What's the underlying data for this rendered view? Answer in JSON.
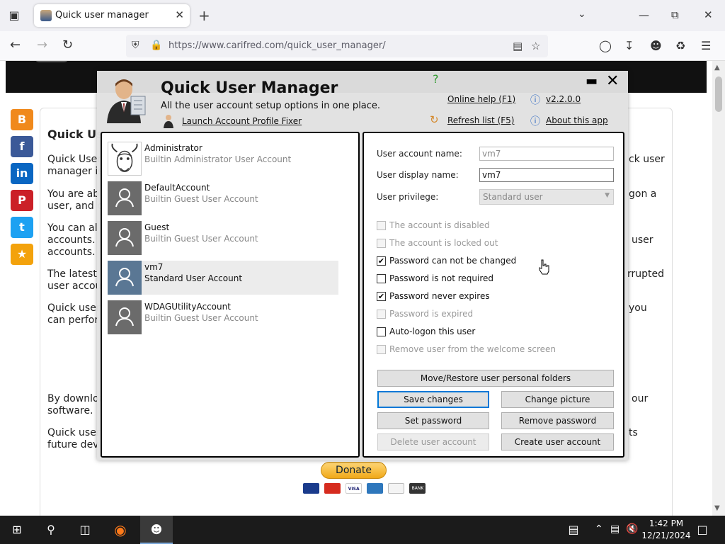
{
  "browser": {
    "tab_title": "Quick user manager",
    "url": "https://www.carifred.com/quick_user_manager/"
  },
  "page": {
    "article_title": "Quick Us",
    "para1_left": "Quick User",
    "para1_left2": "manager is",
    "para1_right": "ck user",
    "para2_left": "You are ab",
    "para2_left2": "user, and c",
    "para2_right": "gon a",
    "para3_left": "You can al",
    "para3_left2": "accounts.",
    "para3_left3": "accounts.",
    "para3_right": "user",
    "para4_left": "The latest",
    "para4_left2": "user accou",
    "para4_right": "rrupted",
    "para5_left": "Quick user",
    "para5_left2": "can perfor",
    "para5_right": "you",
    "para6_left": "By downloa",
    "para6_left2": "software.",
    "para6_right": "our",
    "para7_left": "Quick user",
    "para7_left2": "future dev",
    "para7_right": "ts",
    "donate_label": "Donate",
    "card_visa": "VISA",
    "card_bank": "BANK"
  },
  "app": {
    "title": "Quick User Manager",
    "subtitle": "All the user account setup options in one place.",
    "fixer_link": "Launch Account Profile Fixer",
    "online_help": "Online help (F1)",
    "refresh": "Refresh list (F5)",
    "version": "v2.2.0.0",
    "about": "About this app",
    "users": [
      {
        "name": "Administrator",
        "desc": "Builtin Administrator User Account"
      },
      {
        "name": "DefaultAccount",
        "desc": "Builtin Guest User Account"
      },
      {
        "name": "Guest",
        "desc": "Builtin Guest User Account"
      },
      {
        "name": "vm7",
        "desc": "Standard User Account"
      },
      {
        "name": "WDAGUtilityAccount",
        "desc": "Builtin Guest User Account"
      }
    ],
    "fields": {
      "account_name_label": "User account name:",
      "account_name_value": "vm7",
      "display_name_label": "User display name:",
      "display_name_value": "vm7",
      "privilege_label": "User privilege:",
      "privilege_value": "Standard user"
    },
    "options": [
      {
        "label": "The account is disabled",
        "checked": false,
        "enabled": false
      },
      {
        "label": "The account is locked out",
        "checked": false,
        "enabled": false
      },
      {
        "label": "Password can not be changed",
        "checked": true,
        "enabled": true
      },
      {
        "label": "Password is not required",
        "checked": false,
        "enabled": true
      },
      {
        "label": "Password never expires",
        "checked": true,
        "enabled": true
      },
      {
        "label": "Password is expired",
        "checked": false,
        "enabled": false
      },
      {
        "label": "Auto-logon this user",
        "checked": false,
        "enabled": true
      },
      {
        "label": "Remove user from the welcome screen",
        "checked": false,
        "enabled": false
      }
    ],
    "buttons": {
      "move_restore": "Move/Restore user personal folders",
      "save": "Save changes",
      "change_picture": "Change picture",
      "set_password": "Set password",
      "remove_password": "Remove password",
      "delete_user": "Delete user account",
      "create_user": "Create user account"
    }
  },
  "taskbar": {
    "time": "1:42 PM",
    "date": "12/21/2024"
  },
  "colors": {
    "selection_avatar": "#5a7794",
    "focus_blue": "#0078d7",
    "taskbar": "#1b1b1b"
  }
}
